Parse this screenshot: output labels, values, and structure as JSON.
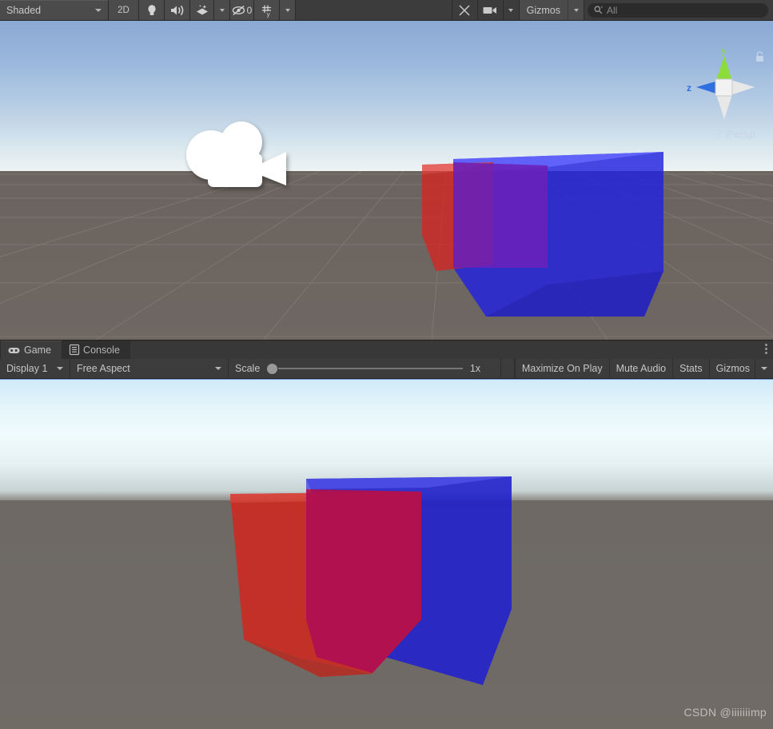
{
  "scene_toolbar": {
    "draw_mode": {
      "label": "Shaded",
      "icon": "chevron-down-icon"
    },
    "toggle_2d": "2D",
    "lighting_icon": "lightbulb-icon",
    "audio_icon": "speaker-icon",
    "fx_icon": "effects-icon",
    "hidden_objects": {
      "icon": "eye-slash-icon",
      "count": "0"
    },
    "grid_icon": "grid-snap-icon",
    "tools_icon": "tools-icon",
    "camera_icon": "camera-icon",
    "gizmos_label": "Gizmos",
    "search": {
      "icon": "search-icon",
      "placeholder": "All",
      "value": ""
    }
  },
  "scene_view": {
    "orientation_gizmo": {
      "axis_y": "y",
      "axis_z": "z",
      "projection": "Persp",
      "lock_icon": "lock-icon",
      "colors": {
        "y": "#8cdc3c",
        "z": "#2f6fe0",
        "x": "#ededed"
      }
    },
    "camera_gizmo_icon": "camera-gizmo-icon",
    "objects": [
      {
        "name": "red-cube",
        "color": "#d8241f",
        "opacity": 0.78
      },
      {
        "name": "blue-cube",
        "color": "#2020df",
        "opacity": 0.8
      },
      {
        "name": "overlap-region",
        "color": "#6a21b8"
      }
    ],
    "sky_color": "#9cb9dd",
    "ground_color": "#6c6560",
    "grid_line_color": "#8b837d"
  },
  "game_panel": {
    "tabs": [
      {
        "label": "Game",
        "icon": "gamepad-icon",
        "active": true
      },
      {
        "label": "Console",
        "icon": "console-log-icon",
        "active": false
      }
    ],
    "overflow_menu_icon": "kebab-menu-icon",
    "controls": {
      "display": {
        "label": "Display 1",
        "icon": "chevron-down-icon"
      },
      "aspect": {
        "label": "Free Aspect",
        "icon": "chevron-down-icon"
      },
      "scale": {
        "label": "Scale",
        "value": "1x",
        "position_pct": 0
      },
      "maximize_on_play": "Maximize On Play",
      "mute_audio": "Mute Audio",
      "stats": "Stats",
      "gizmos": "Gizmos",
      "gizmos_caret": "chevron-down-icon"
    }
  },
  "game_view": {
    "objects": [
      {
        "name": "red-cube",
        "color": "#cc2a22",
        "opacity": 0.85
      },
      {
        "name": "blue-cube",
        "color": "#2222cc",
        "opacity": 0.88
      },
      {
        "name": "overlap-region",
        "color": "#b01050"
      }
    ],
    "sky_color": "#e4f5fb",
    "ground_color": "#6f6a65",
    "watermark": "CSDN @iiiiiiimp"
  }
}
